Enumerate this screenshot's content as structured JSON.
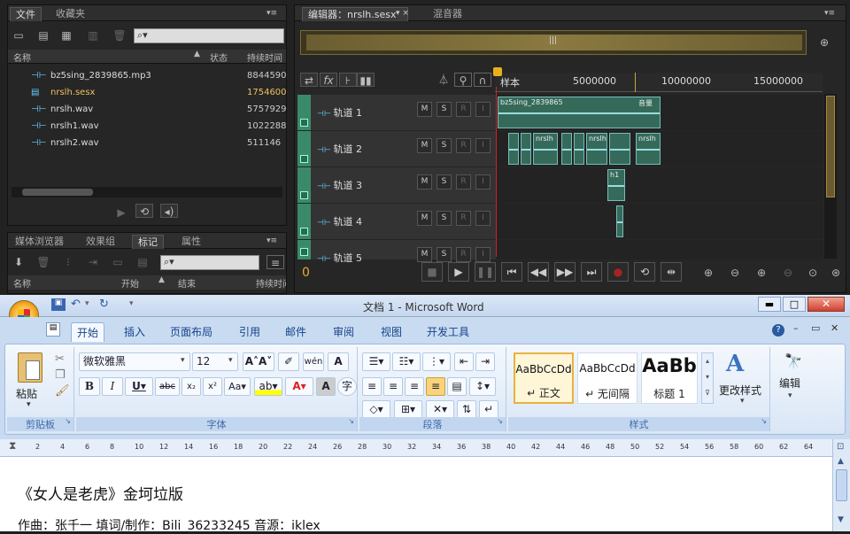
{
  "audition": {
    "files_panel": {
      "tabs": [
        "文件",
        "收藏夹"
      ],
      "search_placeholder": "",
      "columns": [
        "名称",
        "状态",
        "持续时间"
      ],
      "files": [
        {
          "name": "bz5sing_2839865.mp3",
          "duration": "8844590",
          "selected": false
        },
        {
          "name": "nrslh.sesx",
          "duration": "1754600",
          "selected": true
        },
        {
          "name": "nrslh.wav",
          "duration": "5757929",
          "selected": false
        },
        {
          "name": "nrslh1.wav",
          "duration": "1022288",
          "selected": false
        },
        {
          "name": "nrslh2.wav",
          "duration": "511146",
          "selected": false
        }
      ]
    },
    "lower_panel": {
      "tabs": [
        "媒体浏览器",
        "效果组",
        "标记",
        "属性"
      ],
      "columns": [
        "名称",
        "开始",
        "结束",
        "持续时间"
      ]
    },
    "editor": {
      "tab": "编辑器：nrslh.sesx",
      "mixer_tab": "混音器",
      "ruler_unit": "样本",
      "ruler_ticks": [
        "5000000",
        "10000000",
        "15000000"
      ],
      "time_display": "0",
      "tracks": [
        {
          "name": "轨道 1",
          "clips": [
            {
              "label": "bz5sing_2839865",
              "extra": "音量"
            }
          ]
        },
        {
          "name": "轨道 2",
          "clips": [
            {
              "label": "nrslh"
            },
            {
              "label": "nrslh"
            },
            {
              "label": "nrslh"
            }
          ]
        },
        {
          "name": "轨道 3",
          "clips": [
            {
              "label": "h1"
            }
          ]
        },
        {
          "name": "轨道 4",
          "clips": [
            {
              "label": ""
            }
          ]
        },
        {
          "name": "轨道 5",
          "clips": []
        }
      ],
      "track_buttons": [
        "M",
        "S",
        "R",
        "I"
      ]
    }
  },
  "word": {
    "title": "文档 1 - Microsoft Word",
    "tabs": [
      "开始",
      "插入",
      "页面布局",
      "引用",
      "邮件",
      "审阅",
      "视图",
      "开发工具"
    ],
    "active_tab": "开始",
    "clipboard": {
      "paste": "粘贴",
      "label": "剪贴板"
    },
    "font": {
      "name": "微软雅黑",
      "size": "12",
      "label": "字体"
    },
    "paragraph_label": "段落",
    "styles": {
      "items": [
        {
          "preview": "AaBbCcDd",
          "name": "↵ 正文"
        },
        {
          "preview": "AaBbCcDd",
          "name": "↵ 无间隔"
        },
        {
          "preview": "AaBb",
          "name": "标题 1"
        }
      ],
      "change": "更改样式",
      "label": "样式"
    },
    "editing": "编辑",
    "ruler_numbers": [
      "2",
      "4",
      "6",
      "8",
      "10",
      "12",
      "14",
      "16",
      "18",
      "20",
      "22",
      "24",
      "26",
      "28",
      "30",
      "32",
      "34",
      "36",
      "38",
      "40",
      "42",
      "44",
      "46",
      "48",
      "50",
      "52",
      "54",
      "56",
      "58",
      "60",
      "62",
      "64"
    ],
    "doc_line1": "《女人是老虎》金坷垃版",
    "doc_line2": "作曲：张千一   填词/制作：Bili_36233245   音源：iklex"
  }
}
